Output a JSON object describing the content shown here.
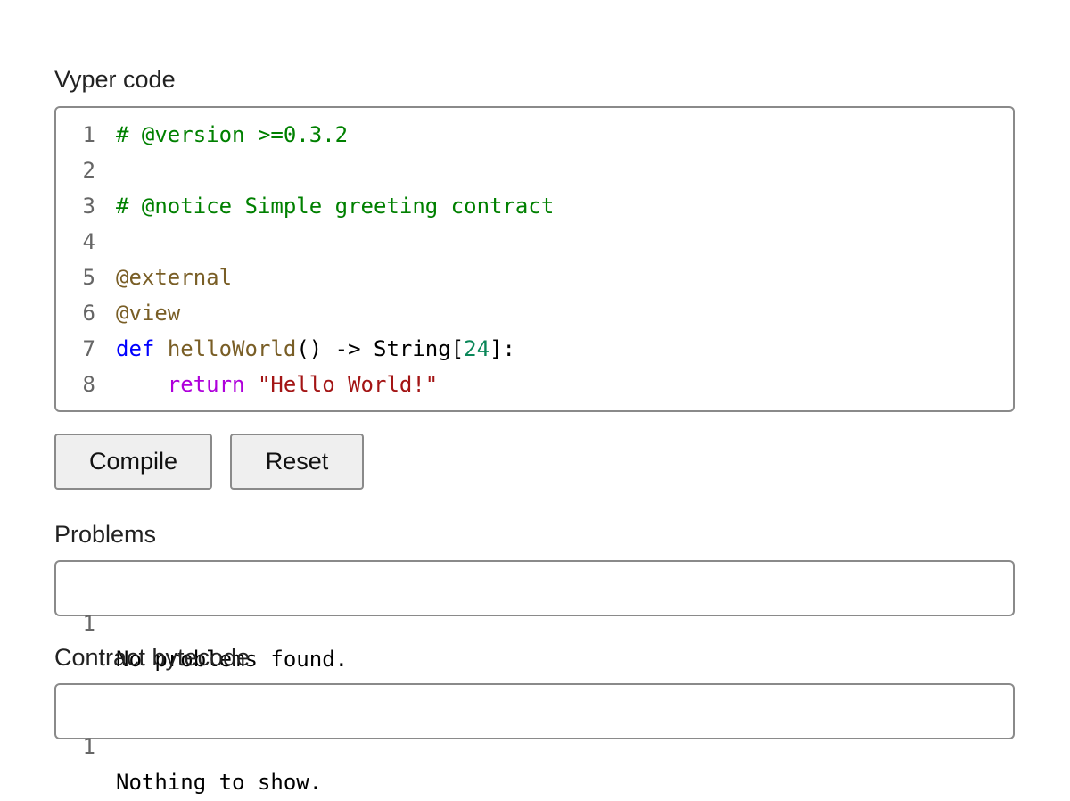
{
  "editor": {
    "label": "Vyper code",
    "lines": [
      {
        "num": "1",
        "tokens": [
          {
            "t": "# @version >=0.3.2",
            "k": "comment"
          }
        ]
      },
      {
        "num": "2",
        "tokens": []
      },
      {
        "num": "3",
        "tokens": [
          {
            "t": "# @notice Simple greeting contract",
            "k": "comment"
          }
        ]
      },
      {
        "num": "4",
        "tokens": []
      },
      {
        "num": "5",
        "tokens": [
          {
            "t": "@external",
            "k": "deco"
          }
        ]
      },
      {
        "num": "6",
        "tokens": [
          {
            "t": "@view",
            "k": "deco"
          }
        ]
      },
      {
        "num": "7",
        "tokens": [
          {
            "t": "def",
            "k": "kw"
          },
          {
            "t": " ",
            "k": "plain"
          },
          {
            "t": "helloWorld",
            "k": "fn"
          },
          {
            "t": "() -> String[",
            "k": "plain"
          },
          {
            "t": "24",
            "k": "num"
          },
          {
            "t": "]:",
            "k": "plain"
          }
        ]
      },
      {
        "num": "8",
        "tokens": [
          {
            "t": "    ",
            "k": "plain"
          },
          {
            "t": "return",
            "k": "ctrl"
          },
          {
            "t": " ",
            "k": "plain"
          },
          {
            "t": "\"Hello World!\"",
            "k": "str"
          }
        ]
      }
    ]
  },
  "actions": {
    "compile_label": "Compile",
    "reset_label": "Reset"
  },
  "problems": {
    "label": "Problems",
    "lines": [
      {
        "num": "1",
        "text": "No problems found."
      }
    ]
  },
  "bytecode": {
    "label": "Contract bytecode",
    "lines": [
      {
        "num": "1",
        "text": "Nothing to show."
      }
    ]
  },
  "colors": {
    "comment": "#008000",
    "decorator": "#795e26",
    "keyword": "#0000ff",
    "function": "#795e26",
    "number": "#098658",
    "control": "#af00db",
    "string": "#a31515",
    "line_number": "#666666"
  }
}
